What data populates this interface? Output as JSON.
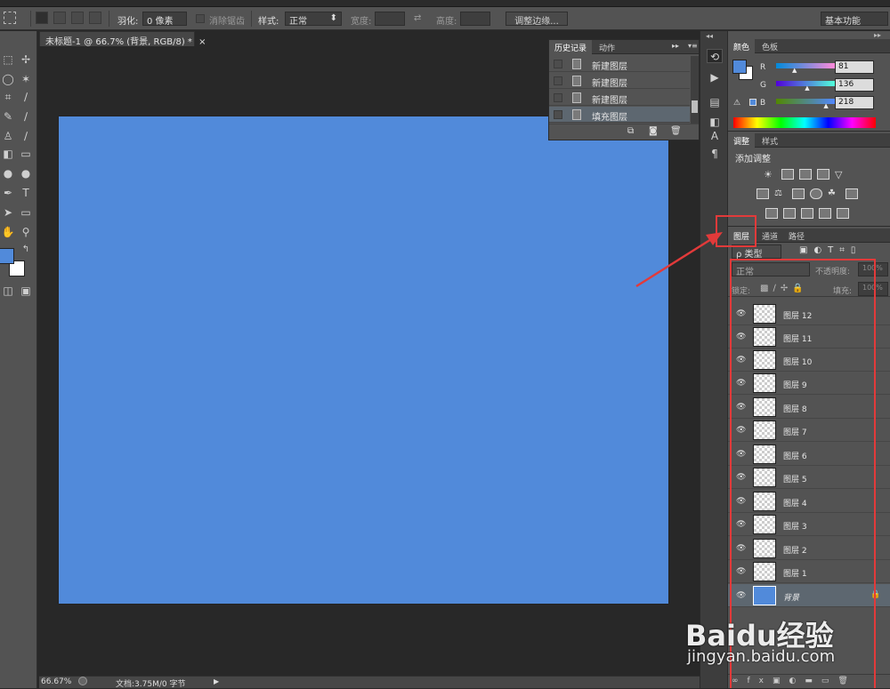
{
  "options_bar": {
    "feather_label": "羽化:",
    "feather_value": "0 像素",
    "antialias_label": "消除锯齿",
    "style_label": "样式:",
    "style_value": "正常",
    "width_label": "宽度:",
    "height_label": "高度:",
    "refine_edge_button": "调整边缘...",
    "workspace_value": "基本功能"
  },
  "document_tab": {
    "title": "未标题-1 @ 66.7% (背景, RGB/8) *",
    "close": "×"
  },
  "canvas": {
    "fill_color": "#518ada"
  },
  "status_bar": {
    "zoom": "66.67%",
    "doc_info": "文档:3.75M/0 字节"
  },
  "history_panel": {
    "tabs": [
      "历史记录",
      "动作"
    ],
    "items": [
      {
        "label": "新建图层",
        "selected": false
      },
      {
        "label": "新建图层",
        "selected": false
      },
      {
        "label": "新建图层",
        "selected": false
      },
      {
        "label": "填充图层",
        "selected": true
      }
    ]
  },
  "color_panel": {
    "tabs": [
      "颜色",
      "色板"
    ],
    "foreground": "#518ada",
    "channels": [
      {
        "name": "R",
        "value": "81"
      },
      {
        "name": "G",
        "value": "136"
      },
      {
        "name": "B",
        "value": "218"
      }
    ]
  },
  "adjust_panel": {
    "tabs": [
      "调整",
      "样式"
    ],
    "heading": "添加调整"
  },
  "layers_panel": {
    "tabs": [
      "图层",
      "通道",
      "路径"
    ],
    "filter_kind": "ρ 类型",
    "blend_mode": "正常",
    "opacity_label": "不透明度:",
    "opacity_value": "100%",
    "lock_label": "锁定:",
    "fill_label": "填充:",
    "fill_value": "100%",
    "layers": [
      {
        "name": "图层 12",
        "active": false
      },
      {
        "name": "图层 11",
        "active": false
      },
      {
        "name": "图层 10",
        "active": false
      },
      {
        "name": "图层 9",
        "active": false
      },
      {
        "name": "图层 8",
        "active": false
      },
      {
        "name": "图层 7",
        "active": false
      },
      {
        "name": "图层 6",
        "active": false
      },
      {
        "name": "图层 5",
        "active": false
      },
      {
        "name": "图层 4",
        "active": false
      },
      {
        "name": "图层 3",
        "active": false
      },
      {
        "name": "图层 2",
        "active": false
      },
      {
        "name": "图层 1",
        "active": false
      },
      {
        "name": "背景",
        "active": true
      }
    ]
  },
  "annotation": {
    "color": "#e23a3a"
  },
  "watermark": {
    "brand": "Baidu经验",
    "url": "jingyan.baidu.com"
  }
}
